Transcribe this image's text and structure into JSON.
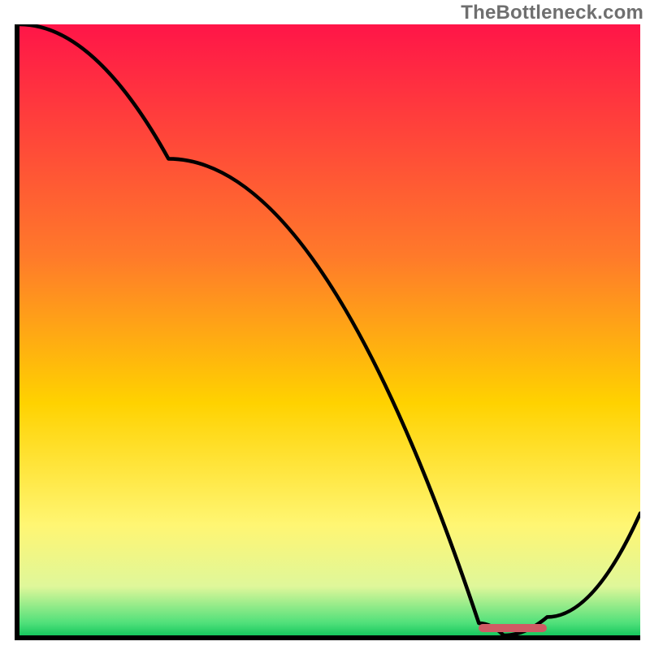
{
  "watermark": "TheBottleneck.com",
  "chart_data": {
    "type": "line",
    "title": "",
    "xlabel": "",
    "ylabel": "",
    "xlim": [
      0,
      100
    ],
    "ylim": [
      0,
      100
    ],
    "x": [
      0,
      24,
      74,
      78,
      85,
      100
    ],
    "values": [
      100,
      78,
      2,
      0,
      3,
      20
    ],
    "optimum_range_x": [
      74,
      85
    ],
    "gradient_stops": [
      {
        "pct": 0,
        "color": "#ff1548"
      },
      {
        "pct": 38,
        "color": "#ff7a2a"
      },
      {
        "pct": 62,
        "color": "#ffd200"
      },
      {
        "pct": 82,
        "color": "#fff673"
      },
      {
        "pct": 92,
        "color": "#dff79a"
      },
      {
        "pct": 98,
        "color": "#4fe07a"
      },
      {
        "pct": 100,
        "color": "#17c85e"
      }
    ]
  },
  "colors": {
    "axis": "#000000",
    "curve": "#000000",
    "optimum_band": "#cf5b64",
    "watermark_text": "#6f6f6f"
  }
}
